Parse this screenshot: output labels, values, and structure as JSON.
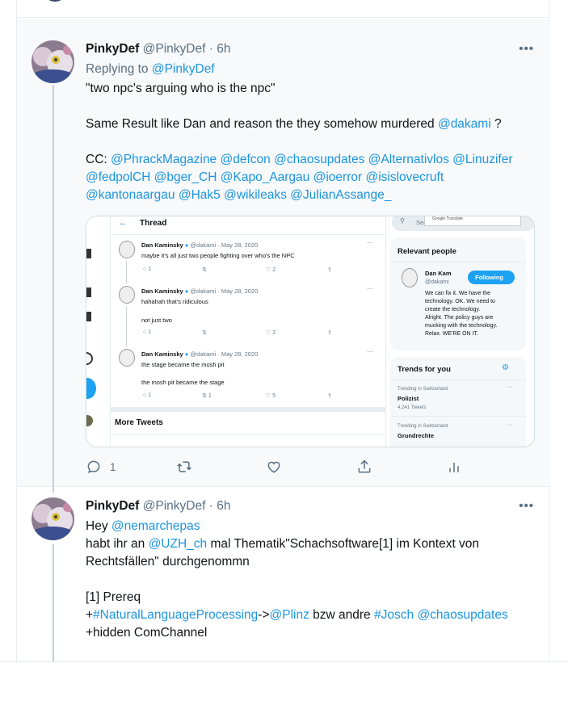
{
  "tweet1": {
    "name": "PinkyDef",
    "handle": "@PinkyDef",
    "dot": " · ",
    "time": "6h",
    "more_label": "•••",
    "reply_prefix": "Replying to ",
    "reply_target": "@PinkyDef",
    "line1": "\"two npc's arguing who is the npc\"",
    "line2_text": "Same Result like Dan and reason the they somehow murdered ",
    "line2_mention": "@dakami",
    "line2_suffix": " ?",
    "cc_label": "CC: ",
    "cc_line1": [
      "@PhrackMagazine",
      "@defcon",
      "@chaosupdates",
      "@Alternativlos",
      "@Linuzifer"
    ],
    "cc_line2": [
      "@fedpolCH",
      "@bger_CH",
      "@Kapo_Aargau",
      "@ioerror",
      "@isislovecruft"
    ],
    "cc_line3": [
      "@kantonaargau",
      "@Hak5",
      "@wikileaks",
      "@JulianAssange_"
    ],
    "reply_count": "1",
    "media": {
      "thread_title": "Thread",
      "search_placeholder": "Sea",
      "search_hint": "Google Translate",
      "entries": [
        {
          "author": "Dan Kaminsky",
          "handle": "@dakami · May 28, 2020",
          "lines": [
            "maybe it's all just two people fighting over who's the NPC"
          ],
          "replies": "1",
          "retweets": "",
          "likes": "2"
        },
        {
          "author": "Dan Kaminsky",
          "handle": "@dakami · May 28, 2020",
          "lines": [
            "hahahah that's ridiculous",
            "",
            "not just two"
          ],
          "replies": "1",
          "retweets": "",
          "likes": "2"
        },
        {
          "author": "Dan Kaminsky",
          "handle": "@dakami · May 28, 2020",
          "lines": [
            "the stage became the mosh pit",
            "",
            "the mosh pit became the stage"
          ],
          "replies": "1",
          "retweets": "1",
          "likes": "5"
        }
      ],
      "more_tweets": "More Tweets",
      "relevant_people_title": "Relevant people",
      "rp_name": "Dan Kam",
      "rp_handle": "@dakami",
      "rp_following": "Following",
      "rp_bio": [
        "We can fix it. We have the",
        "technology. OK. We need to",
        "create the technology.",
        "Alright. The policy guys are",
        "mucking with the technology.",
        "Relax. WE'RE ON IT."
      ],
      "trends_title": "Trends for you",
      "trends": [
        {
          "context": "Trending in Switzerland",
          "name": "Polizist",
          "count": "4,241 Tweets"
        },
        {
          "context": "Trending in Switzerland",
          "name": "Grundrechte",
          "count": ""
        }
      ]
    }
  },
  "tweet2": {
    "name": "PinkyDef",
    "handle": "@PinkyDef",
    "dot": " · ",
    "time": "6h",
    "more_label": "•••",
    "hey": "Hey ",
    "hey_mention": "@nemarchepas",
    "line2_prefix": "habt ihr an ",
    "line2_mention": "@UZH_ch",
    "line2_suffix": " mal Thematik\"Schachsoftware[1] im Kontext von",
    "line3": "Rechtsfällen\" durchgenommn",
    "line4": "[1] Prereq",
    "line5_plus": "+",
    "line5_hashtag": "#NaturalLanguageProcessing",
    "line5_arrow": "->",
    "line5_mention": "@Plinz",
    "line5_mid": " bzw andre ",
    "line5_hashtag2": "#Josch",
    "line5_mention2": "@chaosupdates",
    "line6": "+hidden ComChannel"
  },
  "colors": {
    "link": "#1b95e0",
    "muted": "#5b7083",
    "highlight_bg": "#f7f9fa"
  },
  "icons": [
    "reply-icon",
    "retweet-icon",
    "like-icon",
    "share-icon",
    "analytics-icon",
    "more-icon"
  ]
}
